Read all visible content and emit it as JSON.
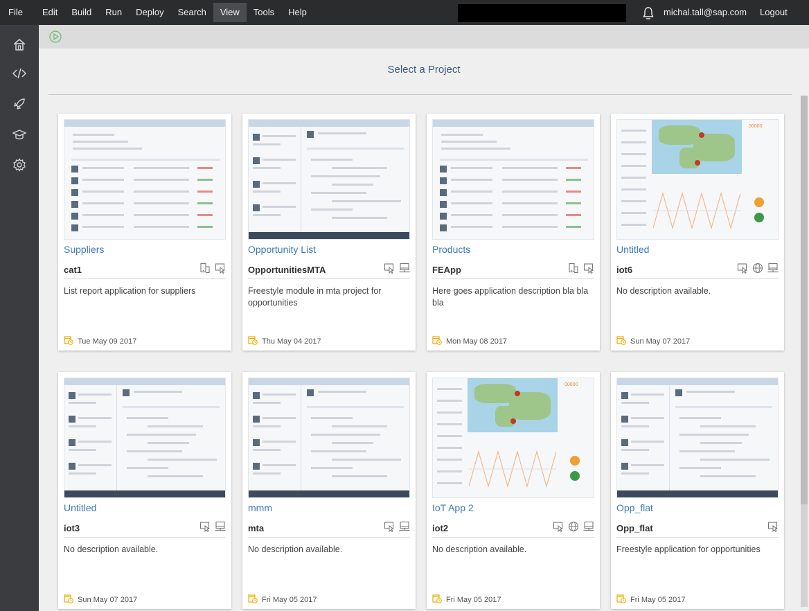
{
  "menu": {
    "items": [
      "File",
      "Edit",
      "Build",
      "Run",
      "Deploy",
      "Search",
      "View",
      "Tools",
      "Help"
    ],
    "active": "View",
    "user": "michal.tall@sap.com",
    "logout": "Logout"
  },
  "sidebar": {
    "items": [
      "home-icon",
      "code-icon",
      "deploy-rocket-icon",
      "learning-center-icon",
      "settings-icon"
    ]
  },
  "main": {
    "title": "Select a Project"
  },
  "cards": [
    {
      "title": "Suppliers",
      "name": "cat1",
      "description": "List report application for suppliers",
      "date": "Tue May 09 2017",
      "icons": [
        "mobile-icon",
        "web-icon"
      ],
      "thumb": "list"
    },
    {
      "title": "Opportunity List",
      "name": "OpportunitiesMTA",
      "description": "Freestyle module in mta project for opportunities",
      "date": "Thu May 04 2017",
      "icons": [
        "web-icon",
        "desktop-icon"
      ],
      "thumb": "detail"
    },
    {
      "title": "Products",
      "name": "FEApp",
      "description": "Here goes application description bla bla bla",
      "date": "Mon May 08 2017",
      "icons": [
        "mobile-icon",
        "web-icon"
      ],
      "thumb": "list"
    },
    {
      "title": "Untitled",
      "name": "iot6",
      "description": "No description available.",
      "date": "Sun May 07 2017",
      "icons": [
        "web-icon",
        "globe-icon",
        "desktop-icon"
      ],
      "thumb": "map"
    },
    {
      "title": "Untitled",
      "name": "iot3",
      "description": "No description available.",
      "date": "Sun May 07 2017",
      "icons": [
        "web-icon",
        "desktop-icon"
      ],
      "thumb": "detail"
    },
    {
      "title": "mmm",
      "name": "mta",
      "description": "No description available.",
      "date": "Fri May 05 2017",
      "icons": [
        "web-icon",
        "desktop-icon"
      ],
      "thumb": "detail"
    },
    {
      "title": "IoT App 2",
      "name": "iot2",
      "description": "No description available.",
      "date": "Fri May 05 2017",
      "icons": [
        "web-icon",
        "globe-icon",
        "desktop-icon"
      ],
      "thumb": "map"
    },
    {
      "title": "Opp_flat",
      "name": "Opp_flat",
      "description": "Freestyle application for opportunities",
      "date": "Fri May 05 2017",
      "icons": [
        "web-icon"
      ],
      "thumb": "detail"
    }
  ],
  "colors": {
    "menubar": "#2b2c2e",
    "sidebar": "#3a3c40",
    "accent": "#3d7ab8",
    "date_icon": "#f0ab00"
  }
}
